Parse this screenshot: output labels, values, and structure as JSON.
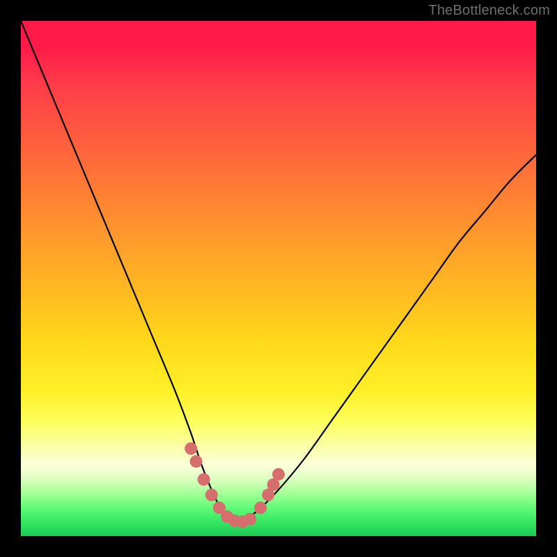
{
  "watermark": "TheBottleneck.com",
  "chart_data": {
    "type": "line",
    "title": "",
    "xlabel": "",
    "ylabel": "",
    "xlim": [
      0,
      100
    ],
    "ylim": [
      0,
      100
    ],
    "grid": false,
    "series": [
      {
        "name": "bottleneck-curve",
        "x": [
          0,
          5,
          10,
          15,
          20,
          25,
          30,
          33,
          35,
          37,
          39,
          41,
          43,
          46,
          50,
          55,
          60,
          65,
          70,
          75,
          80,
          85,
          90,
          95,
          100
        ],
        "values": [
          100,
          88,
          76,
          64,
          52,
          40,
          28,
          20,
          14,
          9,
          5,
          3,
          3,
          5,
          9,
          15,
          22,
          29,
          36,
          43,
          50,
          57,
          63,
          69,
          74
        ]
      }
    ],
    "markers": [
      {
        "name": "dot-left-1",
        "x": 33.0,
        "y": 17.0
      },
      {
        "name": "dot-left-2",
        "x": 34.0,
        "y": 14.5
      },
      {
        "name": "dot-left-3",
        "x": 35.5,
        "y": 11.0
      },
      {
        "name": "dot-left-4",
        "x": 37.0,
        "y": 8.0
      },
      {
        "name": "dot-left-5",
        "x": 38.5,
        "y": 5.5
      },
      {
        "name": "dot-bottom-1",
        "x": 40.0,
        "y": 3.8
      },
      {
        "name": "dot-bottom-2",
        "x": 41.5,
        "y": 3.0
      },
      {
        "name": "dot-bottom-3",
        "x": 43.0,
        "y": 2.8
      },
      {
        "name": "dot-bottom-4",
        "x": 44.5,
        "y": 3.3
      },
      {
        "name": "dot-right-1",
        "x": 46.5,
        "y": 5.5
      },
      {
        "name": "dot-right-2",
        "x": 48.0,
        "y": 8.0
      },
      {
        "name": "dot-right-3",
        "x": 49.0,
        "y": 10.0
      },
      {
        "name": "dot-right-4",
        "x": 50.0,
        "y": 12.0
      }
    ],
    "marker_color": "#d66e6e",
    "curve_color": "#000000"
  }
}
